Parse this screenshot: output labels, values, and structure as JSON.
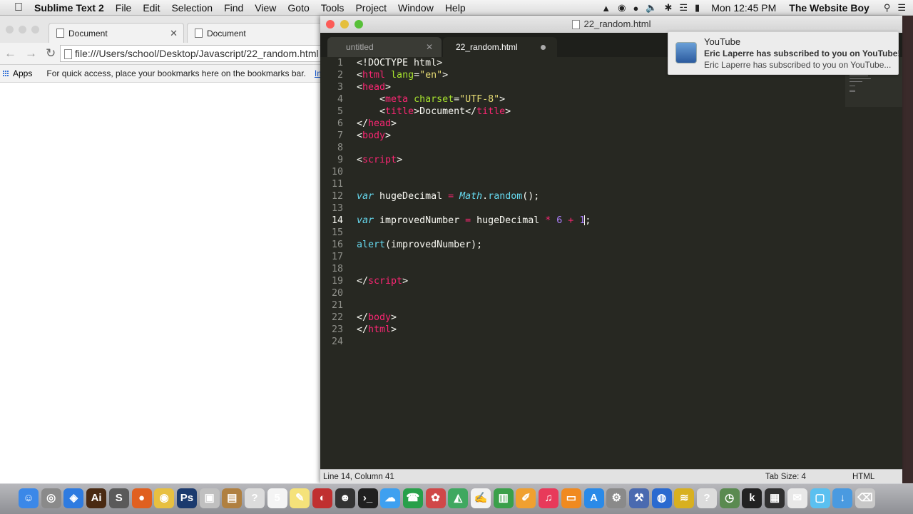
{
  "menubar": {
    "app": "Sublime Text 2",
    "items": [
      "File",
      "Edit",
      "Selection",
      "Find",
      "View",
      "Goto",
      "Tools",
      "Project",
      "Window",
      "Help"
    ],
    "clock": "Mon 12:45 PM",
    "user": "The Website Boy"
  },
  "chrome": {
    "tabs": [
      "Document",
      "Document"
    ],
    "url": "file:///Users/school/Desktop/Javascript/22_random.html",
    "bookmarks": {
      "apps": "Apps",
      "hint": "For quick access, place your bookmarks here on the bookmarks bar.",
      "import": "Imp"
    }
  },
  "sublime": {
    "title": "22_random.html",
    "tabs": [
      "untitled",
      "22_random.html"
    ],
    "line_numbers": [
      "1",
      "2",
      "3",
      "4",
      "5",
      "6",
      "7",
      "8",
      "9",
      "10",
      "11",
      "12",
      "13",
      "14",
      "15",
      "16",
      "17",
      "18",
      "19",
      "20",
      "21",
      "22",
      "23",
      "24"
    ],
    "active_line": 14,
    "status": {
      "position": "Line 14, Column 41",
      "tab_size": "Tab Size: 4",
      "syntax": "HTML"
    }
  },
  "notification": {
    "title": "YouTube",
    "subtitle": "Eric Laperre has subscribed to you on YouTube!",
    "body": "Eric Laperre has subscribed to you on YouTube..."
  },
  "dock": {
    "apps": [
      "Finder",
      "Launchpad",
      "Safari",
      "Illustrator",
      "Sublime Text",
      "Firefox",
      "Chrome",
      "Photoshop",
      "Preview",
      "Archive",
      "Help",
      "Calendar",
      "Notes",
      "Photo Booth",
      "Game Center",
      "Terminal",
      "Messages",
      "FaceTime",
      "Photo",
      "Maps",
      "TextEdit",
      "Numbers",
      "Pages",
      "iTunes",
      "iBooks",
      "App Store",
      "System Preferences",
      "Xcode",
      "Network",
      "Wi-Fi Scanner",
      "Help",
      "Time Machine",
      "Kindle",
      "Activity Monitor",
      "Mail",
      "Folder",
      "Downloads",
      "Trash"
    ]
  }
}
